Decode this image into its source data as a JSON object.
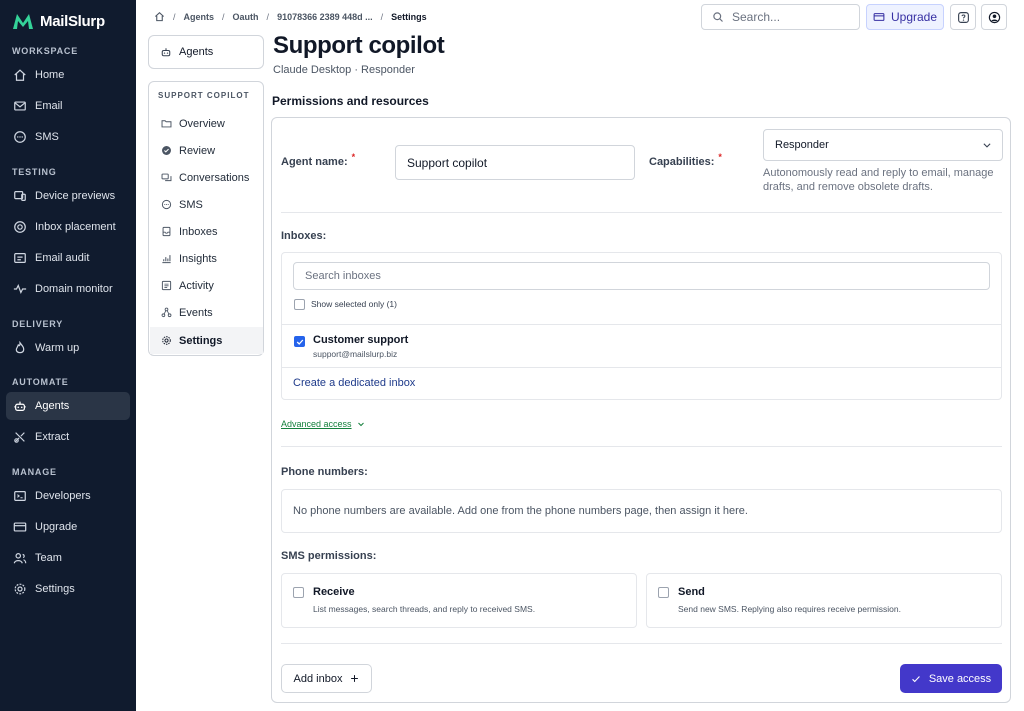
{
  "app": {
    "brand": "MailSlurp"
  },
  "sidebar": {
    "sections": [
      {
        "label": "WORKSPACE"
      },
      {
        "label": "TESTING"
      },
      {
        "label": "DELIVERY"
      },
      {
        "label": "AUTOMATE"
      },
      {
        "label": "MANAGE"
      }
    ],
    "items": [
      {
        "label": "Home",
        "icon": "home-icon"
      },
      {
        "label": "Email",
        "icon": "mail-icon"
      },
      {
        "label": "SMS",
        "icon": "chat-icon"
      },
      {
        "label": "Device previews",
        "icon": "devices-icon"
      },
      {
        "label": "Inbox placement",
        "icon": "target-icon"
      },
      {
        "label": "Email audit",
        "icon": "audit-icon"
      },
      {
        "label": "Domain monitor",
        "icon": "pulse-icon"
      },
      {
        "label": "Warm up",
        "icon": "flame-icon"
      },
      {
        "label": "Agents",
        "icon": "robot-icon",
        "active": true
      },
      {
        "label": "Extract",
        "icon": "extract-icon"
      },
      {
        "label": "Developers",
        "icon": "terminal-icon"
      },
      {
        "label": "Upgrade",
        "icon": "card-icon"
      },
      {
        "label": "Team",
        "icon": "team-icon"
      },
      {
        "label": "Settings",
        "icon": "gear-icon"
      }
    ]
  },
  "topbar": {
    "breadcrumbs": [
      "Agents",
      "Oauth",
      "91078366 2389 448d ...",
      "Settings"
    ],
    "search_placeholder": "Search...",
    "upgrade_label": "Upgrade"
  },
  "subnav": {
    "back_label": "Agents",
    "header": "SUPPORT COPILOT",
    "items": [
      {
        "label": "Overview",
        "icon": "folder-icon"
      },
      {
        "label": "Review",
        "icon": "check-circle-icon"
      },
      {
        "label": "Conversations",
        "icon": "conversations-icon"
      },
      {
        "label": "SMS",
        "icon": "chat-icon"
      },
      {
        "label": "Inboxes",
        "icon": "inbox-icon"
      },
      {
        "label": "Insights",
        "icon": "chart-icon"
      },
      {
        "label": "Activity",
        "icon": "activity-icon"
      },
      {
        "label": "Events",
        "icon": "events-icon"
      },
      {
        "label": "Settings",
        "icon": "gear-icon",
        "active": true
      }
    ]
  },
  "page": {
    "title": "Support copilot",
    "subtitle": "Claude Desktop · Responder",
    "section_title": "Permissions and resources"
  },
  "form": {
    "agent_name_label": "Agent name:",
    "agent_name_value": "Support copilot",
    "capabilities_label": "Capabilities:",
    "capabilities_value": "Responder",
    "capabilities_help": "Autonomously read and reply to email, manage drafts, and remove obsolete drafts.",
    "required_mark": "*",
    "inboxes_label": "Inboxes:",
    "search_inboxes_placeholder": "Search inboxes",
    "show_selected_label": "Show selected only (1)",
    "inbox": {
      "name": "Customer support",
      "email": "support@mailslurp.biz",
      "checked": true
    },
    "create_inbox_link": "Create a dedicated inbox",
    "advanced_access": "Advanced access",
    "phone_label": "Phone numbers:",
    "phone_empty": "No phone numbers are available. Add one from the phone numbers page, then assign it here.",
    "sms_label": "SMS permissions:",
    "sms_receive": {
      "title": "Receive",
      "desc": "List messages, search threads, and reply to received SMS."
    },
    "sms_send": {
      "title": "Send",
      "desc": "Send new SMS. Replying also requires receive permission."
    },
    "add_inbox_label": "Add inbox",
    "save_label": "Save access"
  },
  "colors": {
    "sidebar_bg": "#101b2e",
    "brand_green": "#34d399",
    "primary": "#4338ca",
    "link_green": "#15803d"
  }
}
